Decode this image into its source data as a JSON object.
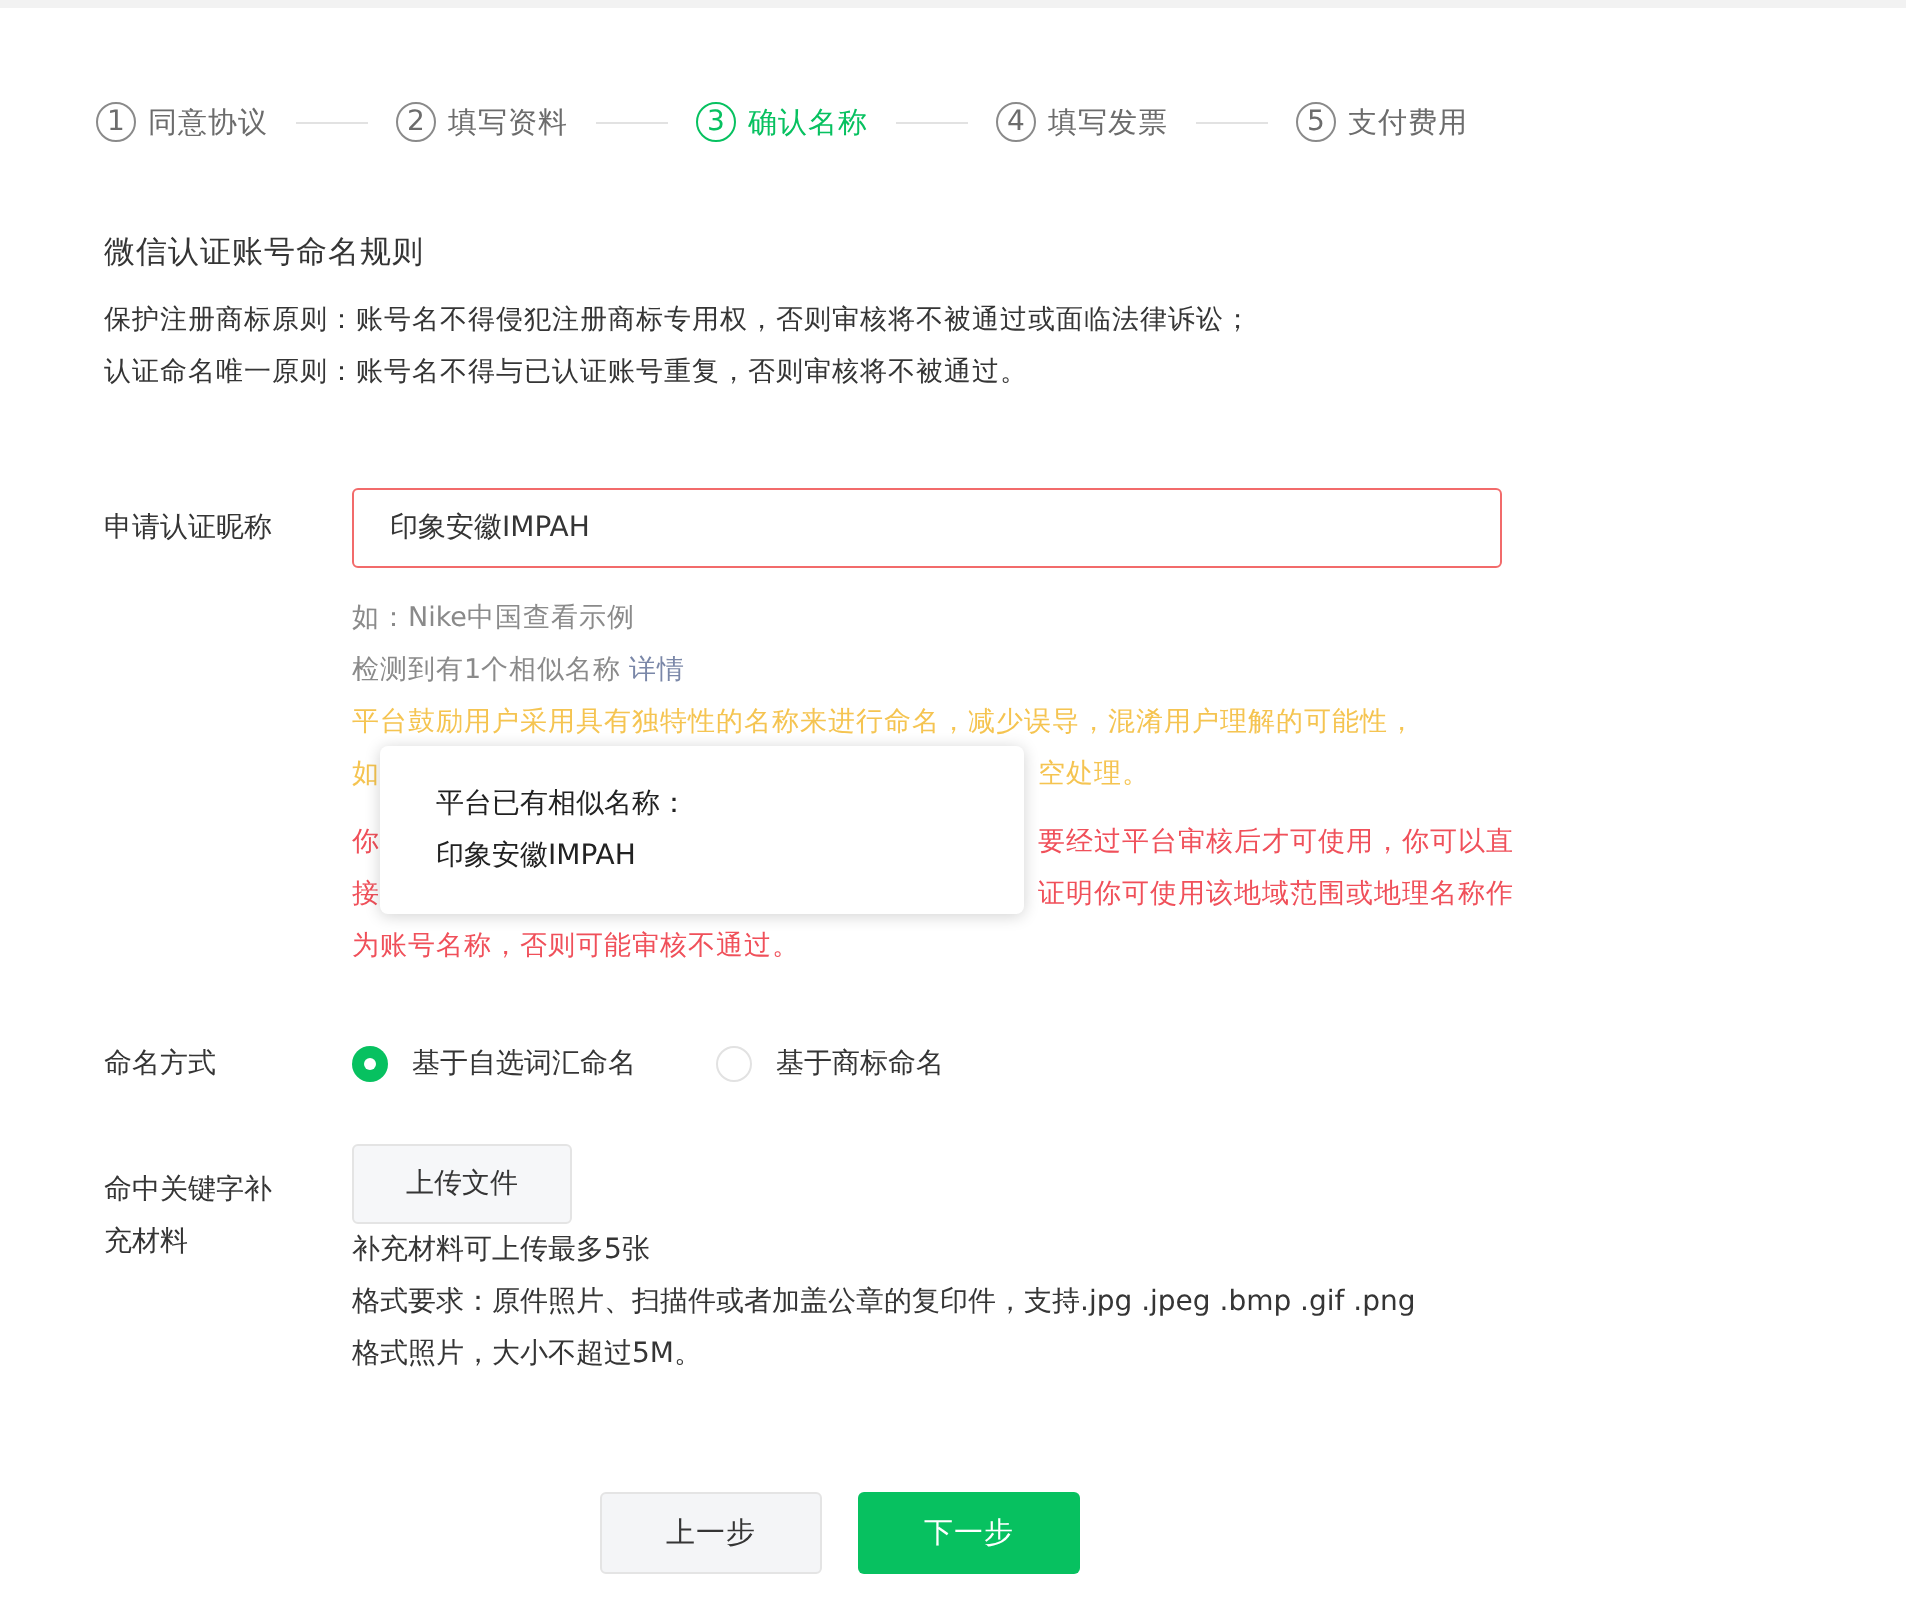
{
  "steps": [
    {
      "number": "1",
      "label": "同意协议",
      "selected": false
    },
    {
      "number": "2",
      "label": "填写资料",
      "selected": false
    },
    {
      "number": "3",
      "label": "确认名称",
      "selected": true
    },
    {
      "number": "4",
      "label": "填写发票",
      "selected": false
    },
    {
      "number": "5",
      "label": "支付费用",
      "selected": false
    }
  ],
  "rules": {
    "title": "微信认证账号命名规则",
    "lines": [
      "保护注册商标原则：账号名不得侵犯注册商标专用权，否则审核将不被通过或面临法律诉讼；",
      "认证命名唯一原则：账号名不得与已认证账号重复，否则审核将不被通过。"
    ]
  },
  "nickname": {
    "label": "申请认证昵称",
    "value": "印象安徽IMPAH",
    "invalid": true
  },
  "hints": {
    "example": "如：Nike中国查看示例",
    "similar": {
      "text": "检测到有1个相似名称",
      "link": "详情"
    }
  },
  "warning_lines": [
    {
      "parts": [
        "平台鼓励用户采用具有独特性的名称来进行命名，减少误导，混淆用户理解的可能性，"
      ]
    },
    {
      "parts": [
        "如",
        "空处理。"
      ]
    }
  ],
  "error_lines": [
    {
      "parts": [
        "你",
        "要经过平台审核后才可使用，你可以直"
      ]
    },
    {
      "parts": [
        "接",
        "证明你可使用该地域范围或地理名称作"
      ]
    },
    {
      "parts": [
        "为账号名称，否则可能审核不通过。"
      ]
    }
  ],
  "popover": {
    "lines": [
      "平台已有相似名称：",
      "印象安徽IMPAH"
    ]
  },
  "naming": {
    "label": "命名方式",
    "options": [
      {
        "label": "基于自选词汇命名",
        "selected": true
      },
      {
        "label": "基于商标命名",
        "selected": false
      }
    ]
  },
  "materials": {
    "label": "命中关键字补充材料",
    "button": "上传文件",
    "notes": [
      "补充材料可上传最多5张",
      "格式要求：原件照片、扫描件或者加盖公章的复印件，支持.jpg .jpeg .bmp .gif .png",
      "格式照片，大小不超过5M。"
    ]
  },
  "buttons": [
    {
      "label": "上一步",
      "kind": "secondary"
    },
    {
      "label": "下一步",
      "kind": "primary"
    }
  ]
}
